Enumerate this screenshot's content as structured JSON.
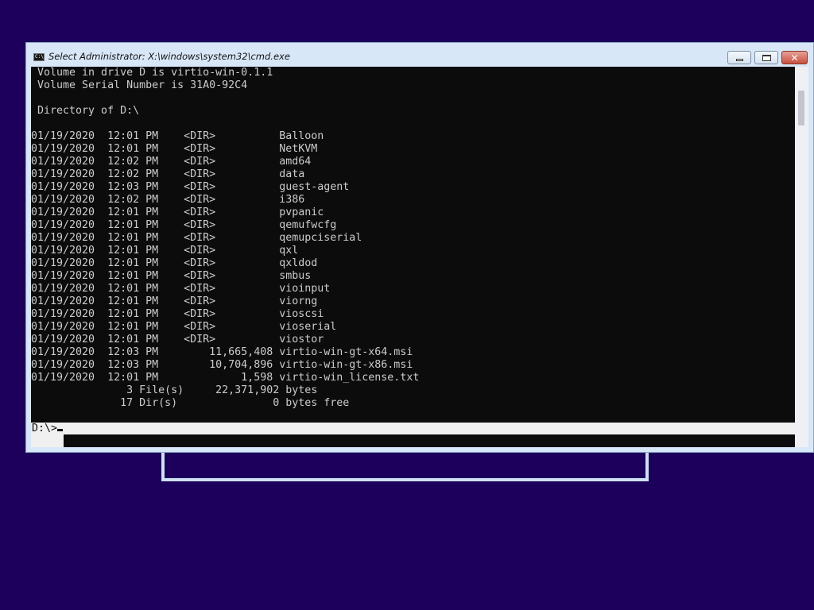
{
  "window": {
    "title": "Select Administrator: X:\\windows\\system32\\cmd.exe",
    "icon": "cmd-icon",
    "icon_glyph": "C:\\",
    "close_glyph": "✕"
  },
  "console": {
    "lines": [
      " Volume in drive D is virtio-win-0.1.1",
      " Volume Serial Number is 31A0-92C4",
      "",
      " Directory of D:\\",
      "",
      "01/19/2020  12:01 PM    <DIR>          Balloon",
      "01/19/2020  12:01 PM    <DIR>          NetKVM",
      "01/19/2020  12:02 PM    <DIR>          amd64",
      "01/19/2020  12:02 PM    <DIR>          data",
      "01/19/2020  12:03 PM    <DIR>          guest-agent",
      "01/19/2020  12:02 PM    <DIR>          i386",
      "01/19/2020  12:01 PM    <DIR>          pvpanic",
      "01/19/2020  12:01 PM    <DIR>          qemufwcfg",
      "01/19/2020  12:01 PM    <DIR>          qemupciserial",
      "01/19/2020  12:01 PM    <DIR>          qxl",
      "01/19/2020  12:01 PM    <DIR>          qxldod",
      "01/19/2020  12:01 PM    <DIR>          smbus",
      "01/19/2020  12:01 PM    <DIR>          vioinput",
      "01/19/2020  12:01 PM    <DIR>          viorng",
      "01/19/2020  12:01 PM    <DIR>          vioscsi",
      "01/19/2020  12:01 PM    <DIR>          vioserial",
      "01/19/2020  12:01 PM    <DIR>          viostor",
      "01/19/2020  12:03 PM        11,665,408 virtio-win-gt-x64.msi",
      "01/19/2020  12:03 PM        10,704,896 virtio-win-gt-x86.msi",
      "01/19/2020  12:01 PM             1,598 virtio-win_license.txt",
      "               3 File(s)     22,371,902 bytes",
      "              17 Dir(s)               0 bytes free"
    ],
    "prompt": "D:\\>"
  },
  "colors": {
    "desktop": "#1c005c",
    "console_bg": "#0c0c0c",
    "console_fg": "#cccccc",
    "title_bar": "#d8e7f7",
    "close_button": "#c7503f"
  }
}
